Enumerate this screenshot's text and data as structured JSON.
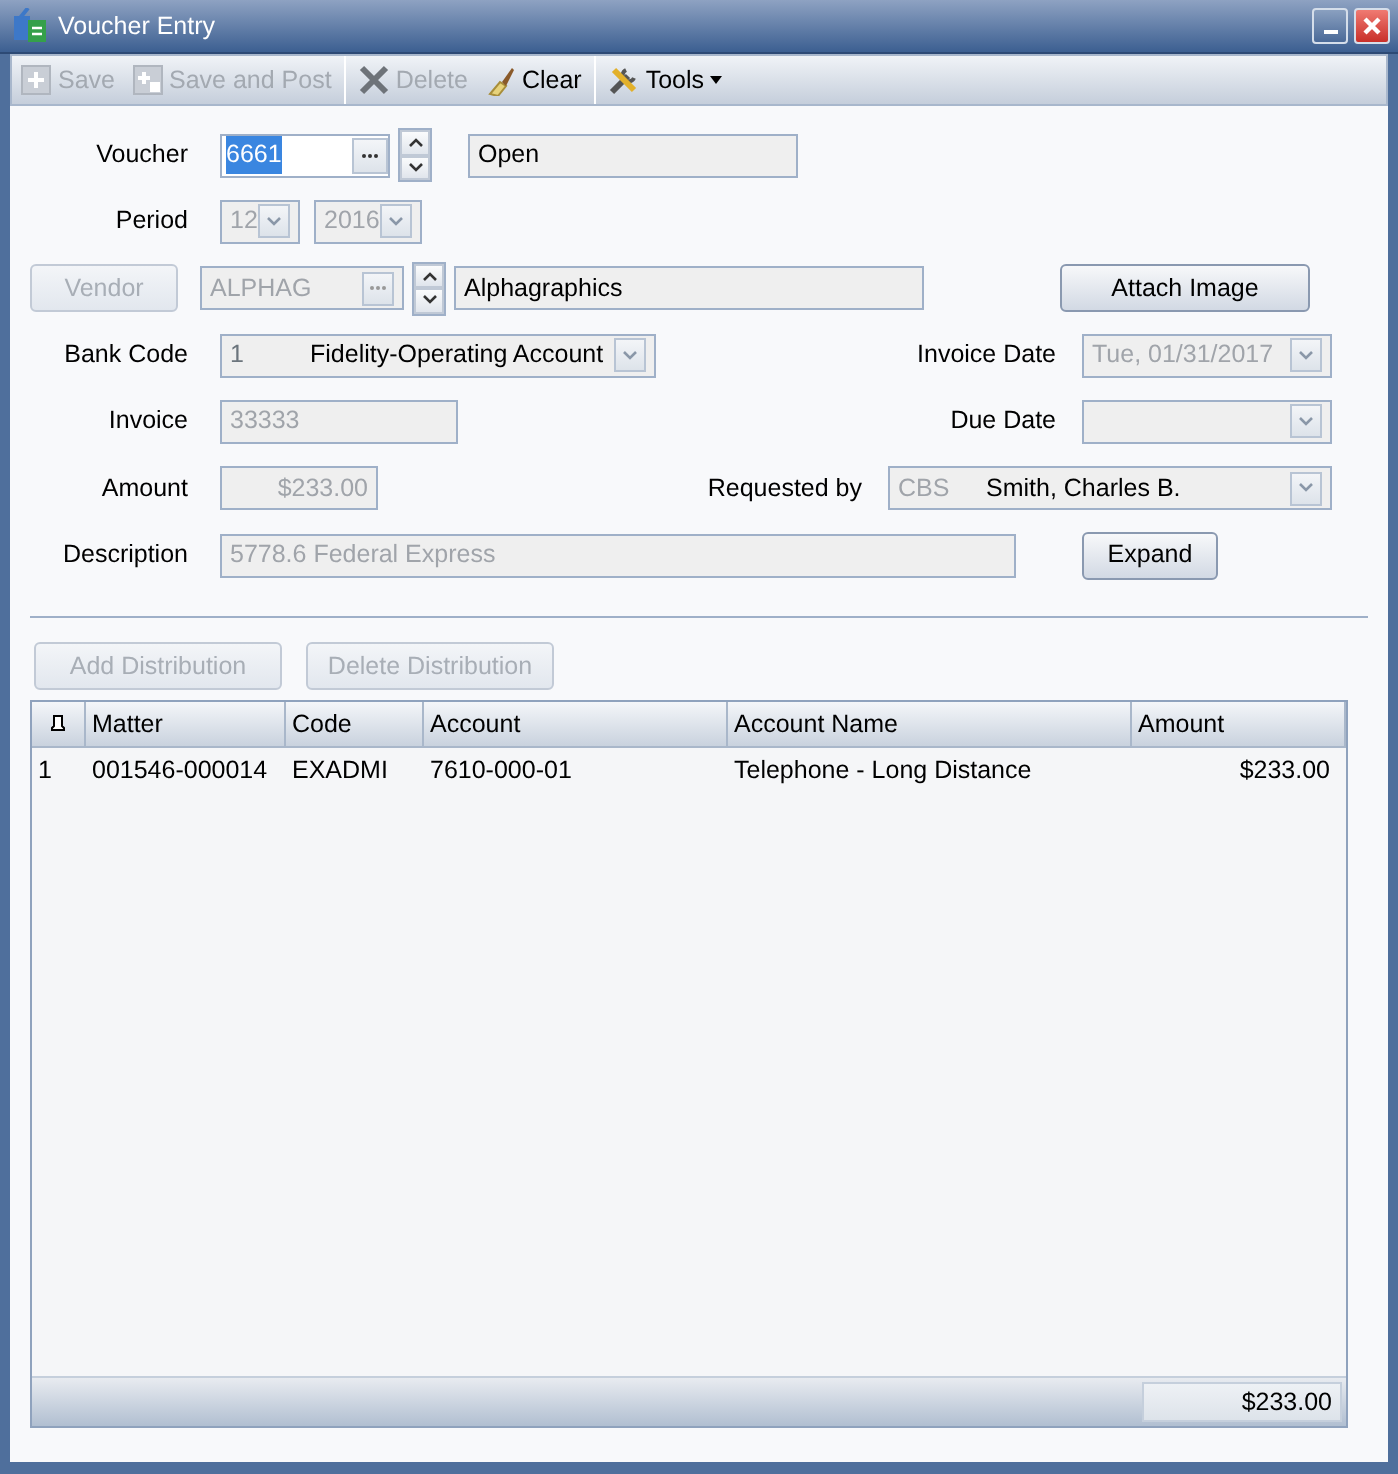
{
  "window": {
    "title": "Voucher Entry"
  },
  "toolbar": [
    {
      "label": "Save",
      "kind": "button",
      "disabled": true
    },
    {
      "label": "Save and Post",
      "kind": "button",
      "disabled": true
    },
    {
      "kind": "separator"
    },
    {
      "label": "Delete",
      "kind": "button",
      "disabled": true
    },
    {
      "label": "Clear",
      "kind": "button",
      "disabled": false
    },
    {
      "kind": "separator"
    },
    {
      "label": "Tools",
      "kind": "dropdown",
      "disabled": false
    }
  ],
  "voucher": {
    "label": "Voucher",
    "value": "6661",
    "text_selected": true,
    "status": "Open"
  },
  "period": {
    "label": "Period",
    "month": "12",
    "year": "2016",
    "disabled": true
  },
  "vendor": {
    "button": "Vendor",
    "button_disabled": true,
    "code": "ALPHAG",
    "code_disabled": true,
    "name": "Alphagraphics"
  },
  "attach_button": {
    "label": "Attach Image",
    "disabled": false
  },
  "bank_code": {
    "label": "Bank Code",
    "code": "1",
    "name": "Fidelity-Operating Account",
    "disabled": true
  },
  "invoice_date": {
    "label": "Invoice Date",
    "value": "Tue, 01/31/2017",
    "disabled": true
  },
  "invoice": {
    "label": "Invoice",
    "value": "33333",
    "disabled": true
  },
  "due_date": {
    "label": "Due Date",
    "disabled": true
  },
  "amount": {
    "label": "Amount",
    "value": "$233.00",
    "disabled": true
  },
  "requested_by": {
    "label": "Requested by",
    "code": "CBS",
    "name": "Smith, Charles B.",
    "disabled": true
  },
  "description": {
    "label": "Description",
    "value": "5778.6 Federal Express",
    "disabled": true
  },
  "expand_button": {
    "label": "Expand",
    "disabled": false
  },
  "distribution_buttons": [
    {
      "label": "Add Distribution",
      "disabled": true
    },
    {
      "label": "Delete Distribution",
      "disabled": true
    }
  ],
  "table": {
    "columns": [
      "",
      "Matter",
      "Code",
      "Account",
      "Account Name",
      "Amount"
    ],
    "rows": [
      [
        "1",
        "001546-000014",
        "EXADMI",
        "7610-000-01",
        "Telephone - Long Distance",
        "$233.00"
      ]
    ],
    "total": "$233.00"
  }
}
